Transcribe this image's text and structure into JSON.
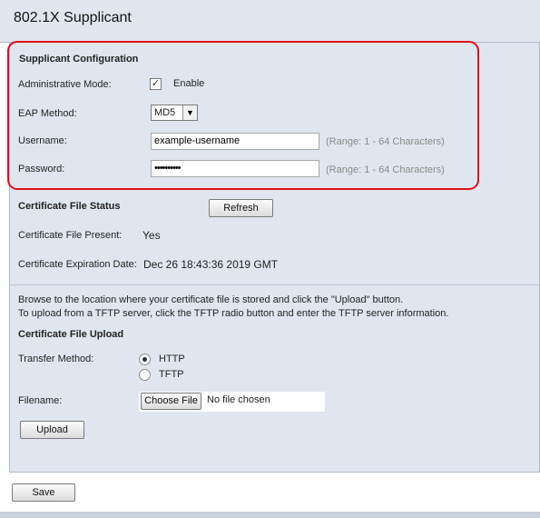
{
  "header": {
    "title": "802.1X Supplicant"
  },
  "supplicant_config": {
    "section_title": "Supplicant Configuration",
    "admin_mode_label": "Administrative Mode:",
    "admin_mode_checked": true,
    "admin_mode_checkbox_label": "Enable",
    "eap_method_label": "EAP Method:",
    "eap_method_value": "MD5",
    "username_label": "Username:",
    "username_value": "example-username",
    "username_hint": "(Range: 1 - 64 Characters)",
    "password_label": "Password:",
    "password_value": "••••••••••",
    "password_hint": "(Range: 1 - 64 Characters)"
  },
  "cert_status": {
    "section_title": "Certificate File Status",
    "refresh_label": "Refresh",
    "present_label": "Certificate File Present:",
    "present_value": "Yes",
    "expiration_label": "Certificate Expiration Date:",
    "expiration_value": "Dec 26 18:43:36 2019 GMT"
  },
  "instructions": {
    "line1": "Browse to the location where your certificate file is stored and click the \"Upload\" button.",
    "line2": "To upload from a TFTP server, click the TFTP radio button and enter the TFTP server information."
  },
  "cert_upload": {
    "section_title": "Certificate File Upload",
    "transfer_method_label": "Transfer Method:",
    "options": [
      {
        "label": "HTTP",
        "selected": true
      },
      {
        "label": "TFTP",
        "selected": false
      }
    ],
    "filename_label": "Filename:",
    "choose_file_label": "Choose File",
    "no_file_text": "No file chosen",
    "upload_label": "Upload"
  },
  "footer": {
    "save_label": "Save"
  },
  "colors": {
    "highlight": "#e0101a",
    "panel_bg": "#dfe6f0"
  }
}
